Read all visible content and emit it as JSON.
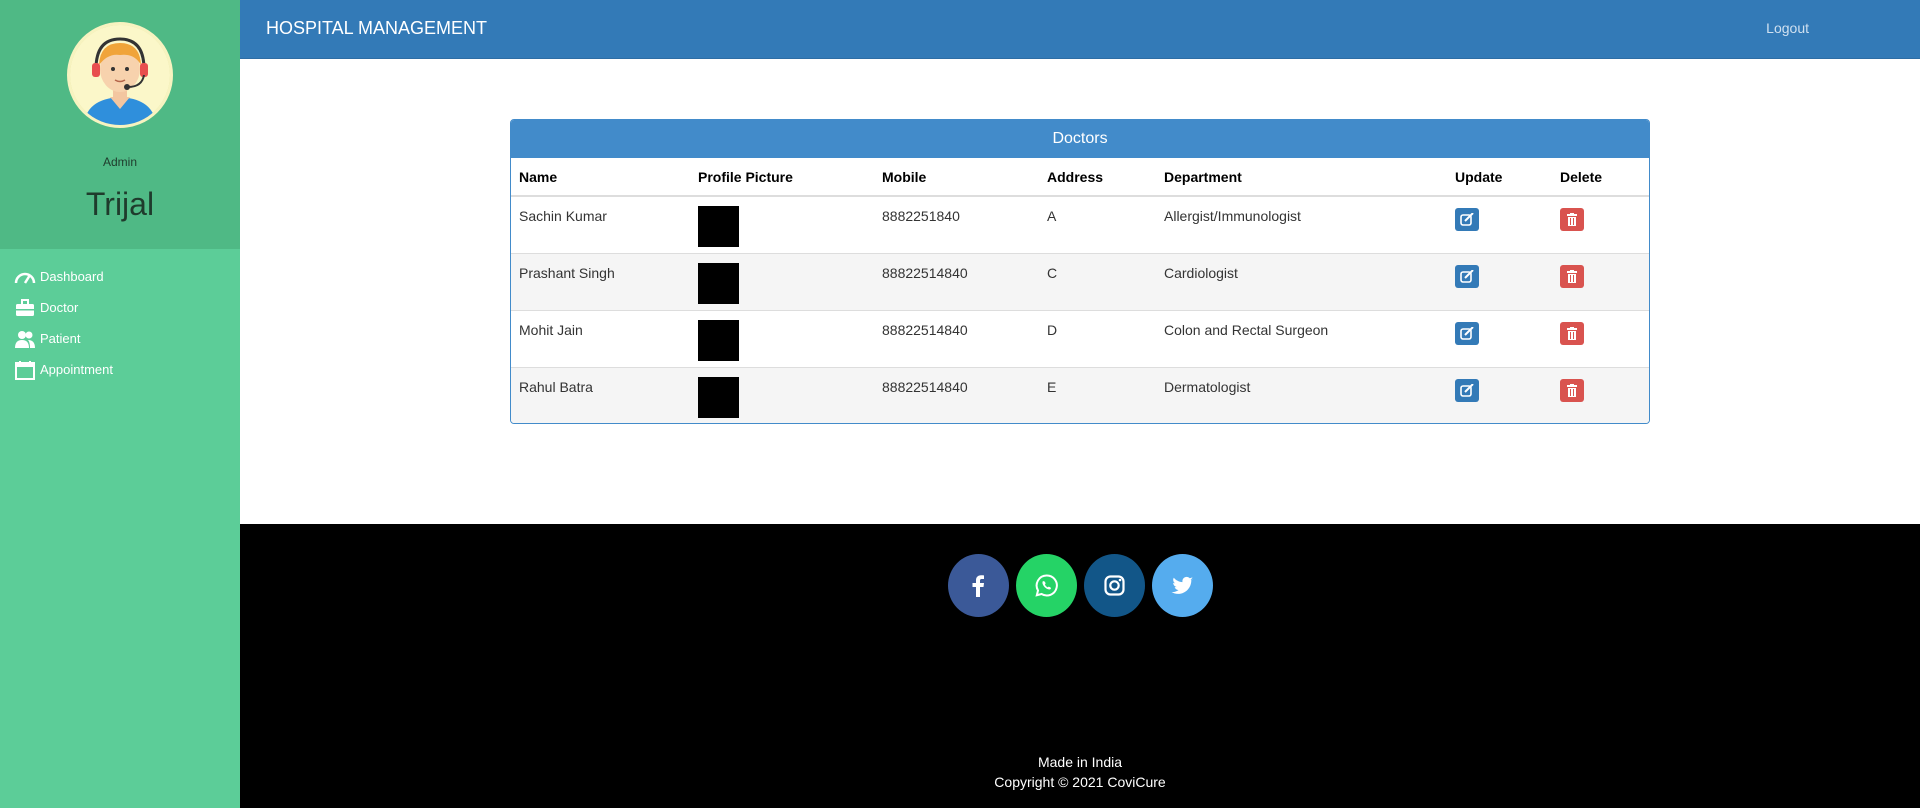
{
  "sidebar": {
    "role": "Admin",
    "username": "Trijal",
    "items": [
      {
        "label": "Dashboard",
        "icon": "dashboard-icon"
      },
      {
        "label": "Doctor",
        "icon": "briefcase-icon"
      },
      {
        "label": "Patient",
        "icon": "user-icon"
      },
      {
        "label": "Appointment",
        "icon": "calendar-icon"
      }
    ]
  },
  "header": {
    "brand": "HOSPITAL MANAGEMENT",
    "logout": "Logout"
  },
  "doctors": {
    "title": "Doctors",
    "columns": [
      "Name",
      "Profile Picture",
      "Mobile",
      "Address",
      "Department",
      "Update",
      "Delete"
    ],
    "rows": [
      {
        "name": "Sachin Kumar",
        "mobile": "8882251840",
        "address": "A",
        "department": "Allergist/Immunologist"
      },
      {
        "name": "Prashant Singh",
        "mobile": "88822514840",
        "address": "C",
        "department": "Cardiologist"
      },
      {
        "name": "Mohit Jain",
        "mobile": "88822514840",
        "address": "D",
        "department": "Colon and Rectal Surgeon"
      },
      {
        "name": "Rahul Batra",
        "mobile": "88822514840",
        "address": "E",
        "department": "Dermatologist"
      }
    ]
  },
  "footer": {
    "social": [
      "facebook-icon",
      "whatsapp-icon",
      "instagram-icon",
      "twitter-icon"
    ],
    "made_in": "Made in India",
    "copyright": "Copyright © 2021 CoviCure"
  },
  "colors": {
    "sidebar": "#5ccd98",
    "profile": "#4fb985",
    "header": "#337ab7",
    "panel": "#428bca",
    "delete": "#d9534f"
  }
}
